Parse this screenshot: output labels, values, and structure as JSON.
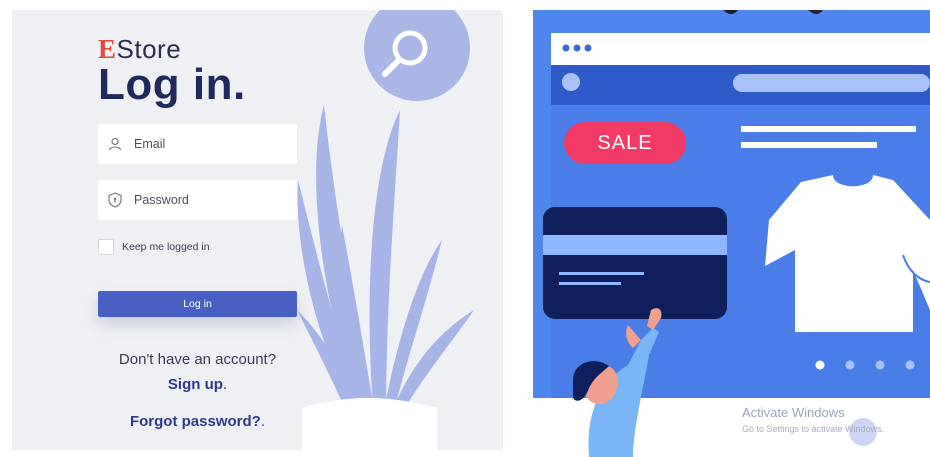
{
  "brand": {
    "accent_letter": "E",
    "rest": "Store"
  },
  "login": {
    "heading": "Log in.",
    "email_placeholder": "Email",
    "password_placeholder": "Password",
    "remember_label": "Keep me logged in",
    "submit_label": "Log in"
  },
  "signup": {
    "prompt": "Don't have an account?",
    "link": "Sign up",
    "suffix": "."
  },
  "forgot": {
    "link": "Forgot password?",
    "suffix": "."
  },
  "illustration": {
    "sale_badge": "SALE"
  },
  "watermark": {
    "title": "Activate Windows",
    "subtitle": "Go to Settings to activate Windows."
  },
  "colors": {
    "primary": "#4860c4",
    "brand_accent": "#e2483d",
    "heading": "#1f2a5a",
    "sale": "#f23a67",
    "hero_bg": "#4f86ee"
  },
  "icons": [
    "user-icon",
    "shield-icon",
    "search-icon"
  ]
}
